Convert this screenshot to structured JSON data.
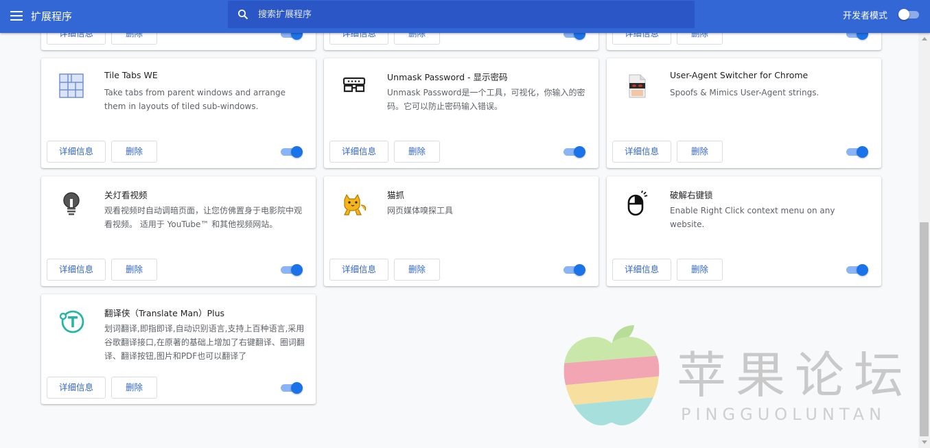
{
  "header": {
    "title": "扩展程序",
    "search_placeholder": "搜索扩展程序",
    "dev_mode_label": "开发者模式",
    "dev_mode_enabled": false
  },
  "buttons": {
    "details": "详细信息",
    "remove": "删除"
  },
  "extensions": [
    {
      "name": "",
      "description": "",
      "enabled": true,
      "icon": "extension-icon"
    },
    {
      "name": "",
      "description": "",
      "enabled": true,
      "icon": "extension-icon"
    },
    {
      "name": "",
      "description": "",
      "enabled": true,
      "icon": "extension-icon"
    },
    {
      "name": "Tile Tabs WE",
      "description": "Take tabs from parent windows and arrange them in layouts of tiled sub-windows.",
      "enabled": true,
      "icon": "tile-grid-icon"
    },
    {
      "name": "Unmask Password - 显示密码",
      "description": "Unmask Password是一个工具，可视化，你输入的密码。它可以防止密码输入错误。",
      "enabled": true,
      "icon": "glasses-icon"
    },
    {
      "name": "User-Agent Switcher for Chrome",
      "description": "Spoofs & Mimics User-Agent strings.",
      "enabled": true,
      "icon": "masked-agent-icon"
    },
    {
      "name": "关灯看视频",
      "description": "观看视频时自动调暗页面，让您仿佛置身于电影院中观看视频。 适用于 YouTube™ 和其他视频网站。",
      "enabled": true,
      "icon": "lightbulb-icon"
    },
    {
      "name": "猫抓",
      "description": "网页媒体嗅探工具",
      "enabled": true,
      "icon": "cat-icon"
    },
    {
      "name": "破解右键锁",
      "description": "Enable Right Click context menu on any website.",
      "enabled": true,
      "icon": "mouse-icon"
    },
    {
      "name": "翻译侠（Translate Man）Plus",
      "description": "划词翻译,即指即译,自动识别语言,支持上百种语言,采用谷歌翻译接口,在原著的基础上增加了右键翻译、圈词翻译、翻译按钮,图片和PDF也可以翻译了",
      "enabled": true,
      "icon": "translate-t-icon"
    }
  ],
  "watermark": {
    "chinese": "苹果论坛",
    "pinyin": "PINGGUOLUNTAN"
  },
  "colors": {
    "header": "#3367d6",
    "search_bg": "#2a56c6",
    "toggle_on": "#1a73e8",
    "link": "#3367d6"
  }
}
